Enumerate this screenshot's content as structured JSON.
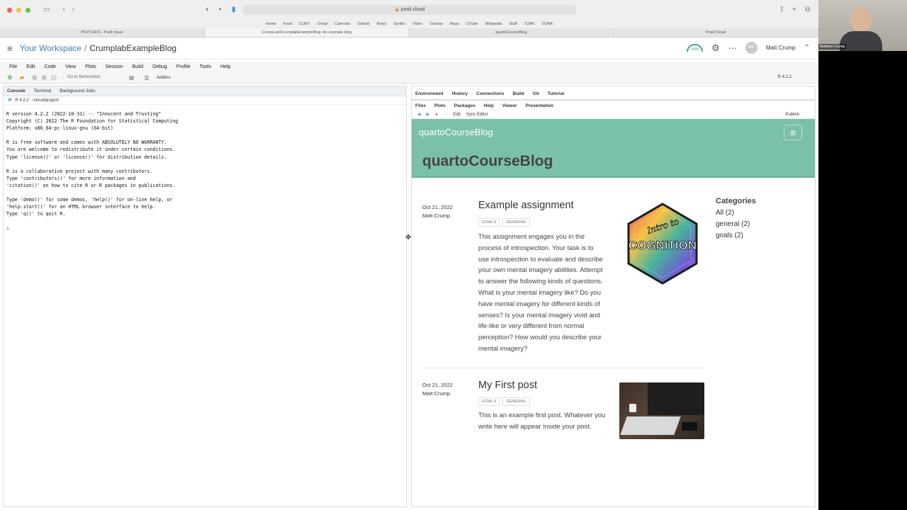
{
  "safari": {
    "url": "posit.cloud",
    "favorites": [
      "Home",
      "Food",
      "CUNY",
      "Gmail",
      "Calendar",
      "GitHub",
      "News",
      "Synths",
      "Video",
      "Scholar",
      "Maps",
      "UTube",
      "Wikipedia",
      "Stuff",
      "TURK",
      "SONA"
    ],
    "tabs": [
      "PSYC3470 - Posit cloud",
      "CrumpLab/CrumplabExampleBlog: An example blog",
      "quartoCourseBlog",
      "Posit Cloud"
    ]
  },
  "posit": {
    "workspace": "Your Workspace",
    "separator": "/",
    "project": "CrumplabExampleBlog",
    "ram_label": "RAM",
    "user_name": "Matt Crump",
    "initials": "MC"
  },
  "rstudio": {
    "menu": [
      "File",
      "Edit",
      "Code",
      "View",
      "Plots",
      "Session",
      "Build",
      "Debug",
      "Profile",
      "Tools",
      "Help"
    ],
    "goto_placeholder": "Go to file/function",
    "addins": "Addins",
    "r_version_badge": "R 4.2.2",
    "console_tabs": [
      "Console",
      "Terminal",
      "Background Jobs"
    ],
    "console_path": "R 4.2.2 · /cloud/project/",
    "console_lines": [
      "R version 4.2.2 (2022-10-31) -- \"Innocent and Trusting\"",
      "Copyright (C) 2022 The R Foundation for Statistical Computing",
      "Platform: x86_64-pc-linux-gnu (64-bit)",
      "",
      "R is free software and comes with ABSOLUTELY NO WARRANTY.",
      "You are welcome to redistribute it under certain conditions.",
      "Type 'license()' or 'licence()' for distribution details.",
      "",
      "R is a collaborative project with many contributors.",
      "Type 'contributors()' for more information and",
      "'citation()' on how to cite R or R packages in publications.",
      "",
      "Type 'demo()' for some demos, 'help()' for on-line help, or",
      "'help.start()' for an HTML browser interface to help.",
      "Type 'q()' to quit R.",
      "",
      ">"
    ],
    "env_tabs": [
      "Environment",
      "History",
      "Connections",
      "Build",
      "Git",
      "Tutorial"
    ],
    "files_tabs": [
      "Files",
      "Plots",
      "Packages",
      "Help",
      "Viewer",
      "Presentation"
    ],
    "viewer_edit": "Edit",
    "sync_editor": "Sync Editor",
    "publish": "Publish"
  },
  "blog": {
    "site_name": "quartoCourseBlog",
    "heading": "quartoCourseBlog",
    "posts": [
      {
        "date": "Oct 21, 2022",
        "author": "Matt Crump",
        "title": "Example assignment",
        "categories": [
          "GOALS",
          "GENERAL"
        ],
        "description": "This assignment engages you in the process of introspection. Your task is to use introspection to evaluate and describe your own mental imagery abilities. Attempt to answer the following kinds of questions. What is your mental imagery like? Do you have mental imagery for different kinds of senses? Is your mental imagery vivid and life-like or very different from normal perception? How would you describe your mental imagery?",
        "thumb_text_top": "Intro to",
        "thumb_text_main": "COGNITION"
      },
      {
        "date": "Oct 21, 2022",
        "author": "Matt Crump",
        "title": "My First post",
        "categories": [
          "GOALS",
          "GENERAL"
        ],
        "description": "This is an example first post. Whatever you write here will appear inside your post."
      }
    ],
    "categories_title": "Categories",
    "categories": [
      "All (2)",
      "general (2)",
      "goals (2)"
    ]
  },
  "webcam": {
    "name": "Matthew Crump"
  },
  "colors": {
    "blog_accent": "#7bc0a8",
    "link": "#3f7fbf"
  }
}
